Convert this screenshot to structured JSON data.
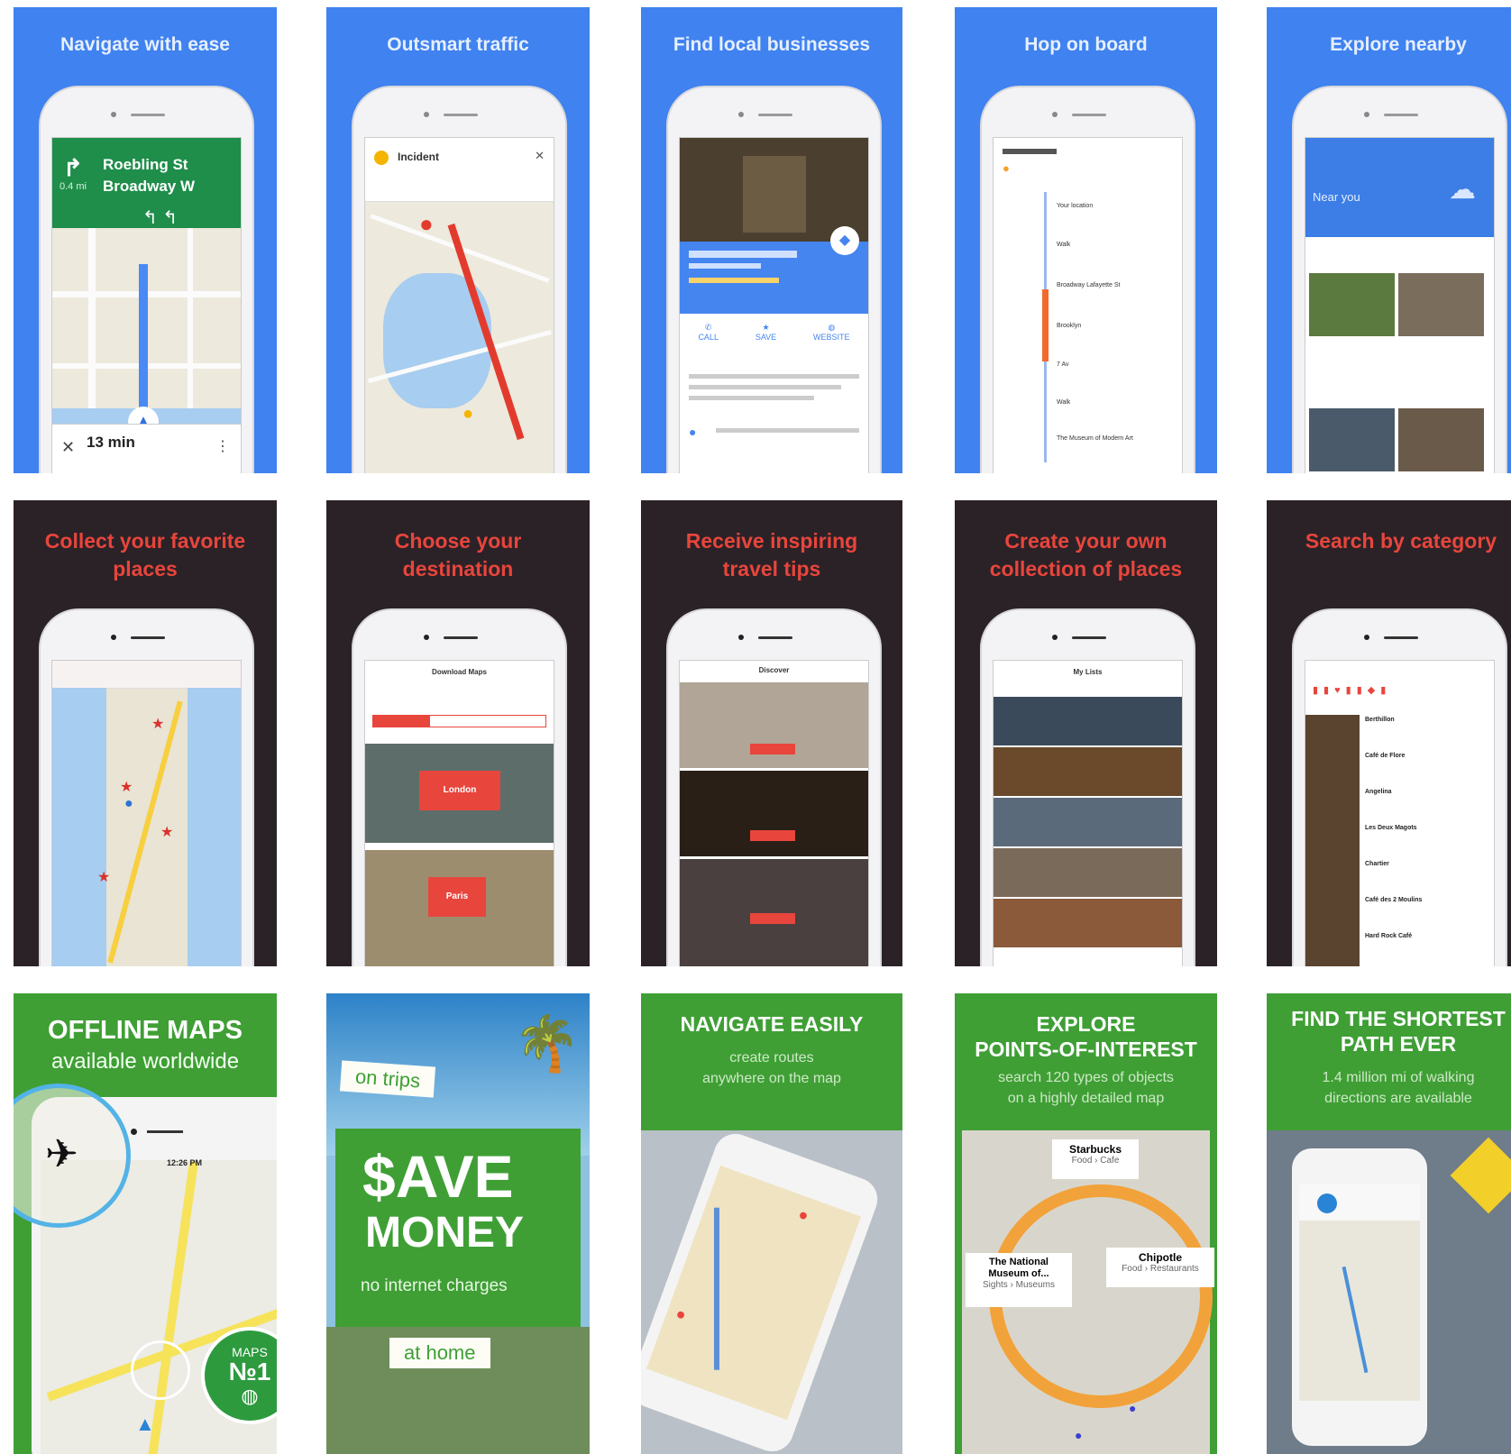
{
  "row1": {
    "titles": [
      "Navigate with ease",
      "Outsmart traffic",
      "Find local businesses",
      "Hop on board",
      "Explore nearby"
    ],
    "nav": {
      "street1": "Roebling St",
      "street2": "Broadway W",
      "distance": "0.4 mi",
      "eta": "13 min"
    },
    "traffic": {
      "card_title": "Incident"
    },
    "business": {
      "actions": [
        "CALL",
        "SAVE",
        "WEBSITE"
      ]
    },
    "transit": {
      "stops": [
        "Your location",
        "Walk",
        "Broadway Lafayette St",
        "Brooklyn",
        "7 Av",
        "Walk",
        "The Museum of Modern Art"
      ]
    },
    "nearby": {
      "header": "Near you"
    }
  },
  "row2": {
    "titles": [
      "Collect your favorite\nplaces",
      "Choose your\ndestination",
      "Receive inspiring\ntravel tips",
      "Create your own\ncollection of places",
      "Search by category"
    ],
    "download": {
      "title": "Download Maps",
      "cities": [
        {
          "name": "London"
        },
        {
          "name": "Paris"
        }
      ]
    },
    "discover": {
      "title": "Discover"
    },
    "lists": {
      "title": "My Lists"
    },
    "category": {
      "items": [
        "Berthillon",
        "Café de Flore",
        "Angelina",
        "Les Deux Magots",
        "Chartier",
        "Café des 2 Moulins",
        "Hard Rock Café"
      ]
    }
  },
  "row3": {
    "offline": {
      "title": "OFFLINE MAPS",
      "subtitle": "available worldwide",
      "badge_top": "MAPS",
      "badge_num": "№1",
      "time": "12:26 PM"
    },
    "save": {
      "tag_top": "on trips",
      "big1": "$AVE",
      "big2": "MONEY",
      "line": "no internet charges",
      "tag_bottom": "at home"
    },
    "navigate": {
      "title": "NAVIGATE EASILY",
      "subtitle": "create routes\nanywhere on the map"
    },
    "explore": {
      "title": "EXPLORE\nPOINTS-OF-INTEREST",
      "subtitle": "search 120 types of objects\non a highly detailed map",
      "pois": [
        {
          "name": "Starbucks",
          "cat": "Food › Cafe"
        },
        {
          "name": "Chipotle",
          "cat": "Food › Restaurants"
        },
        {
          "name": "The National\nMuseum of...",
          "cat": "Sights › Museums"
        }
      ]
    },
    "shortest": {
      "title": "FIND THE SHORTEST\nPATH EVER",
      "subtitle": "1.4 million mi of walking\ndirections are available"
    }
  },
  "colors": {
    "blue": "#3f82f0",
    "dark": "#2b2227",
    "red": "#e8453c",
    "green": "#3f9f35",
    "nav_green": "#1e8e4a"
  }
}
